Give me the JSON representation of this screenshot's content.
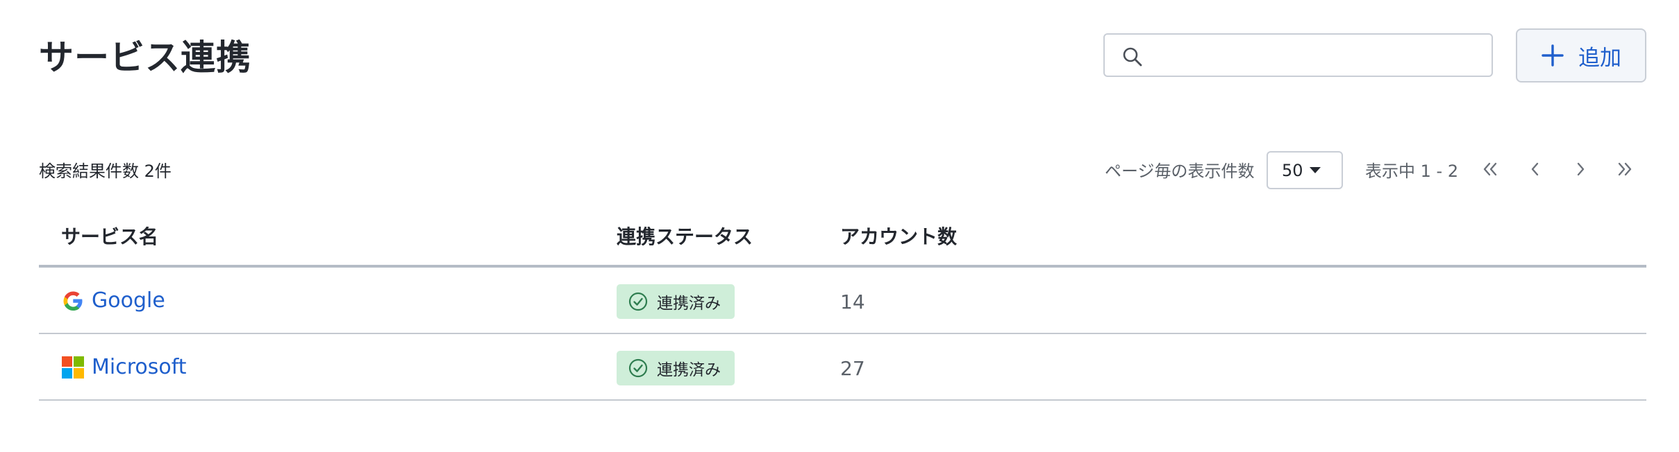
{
  "header": {
    "title": "サービス連携",
    "search": {
      "value": "",
      "placeholder": ""
    },
    "add_button_label": "追加"
  },
  "toolbar": {
    "result_count": "検索結果件数 2件",
    "per_page_label": "ページ毎の表示件数",
    "per_page_value": "50",
    "showing": "表示中 1 - 2"
  },
  "table": {
    "columns": [
      "サービス名",
      "連携ステータス",
      "アカウント数"
    ],
    "rows": [
      {
        "service": "Google",
        "logo": "google-logo",
        "status": "連携済み",
        "accounts": "14"
      },
      {
        "service": "Microsoft",
        "logo": "microsoft-logo",
        "status": "連携済み",
        "accounts": "27"
      }
    ]
  },
  "colors": {
    "link": "#1f5fcc",
    "status_bg": "#cfeed9",
    "status_icon": "#2e7d4f"
  },
  "icons": [
    "search-icon",
    "plus-icon",
    "caret-down-icon",
    "first-page-icon",
    "prev-page-icon",
    "next-page-icon",
    "last-page-icon",
    "check-circle-icon"
  ]
}
